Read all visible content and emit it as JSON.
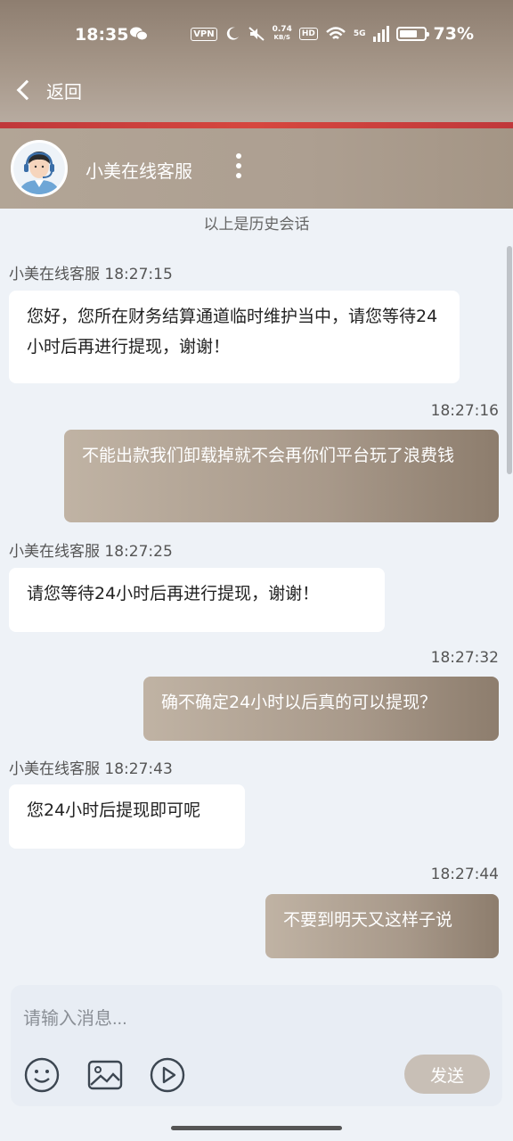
{
  "status_bar": {
    "time": "18:35",
    "vpn": "VPN",
    "net_speed_value": "0.74",
    "net_speed_unit": "KB/S",
    "hd": "HD",
    "signal_label": "5G",
    "battery_percent": "73%",
    "battery_level": 0.73
  },
  "nav": {
    "back_label": "返回"
  },
  "chat_header": {
    "title": "小美在线客服"
  },
  "messages": {
    "history_note": "以上是历史会话",
    "items": [
      {
        "side": "left",
        "meta": "小美在线客服 18:27:15",
        "text": "您好，您所在财务结算通道临时维护当中，请您等待24小时后再进行提现，谢谢！"
      },
      {
        "side": "right",
        "meta": "18:27:16",
        "text": "不能出款我们卸载掉就不会再你们平台玩了浪费钱"
      },
      {
        "side": "left",
        "meta": "小美在线客服 18:27:25",
        "text": "请您等待24小时后再进行提现，谢谢！"
      },
      {
        "side": "right",
        "meta": "18:27:32",
        "text": "确不确定24小时以后真的可以提现？"
      },
      {
        "side": "left",
        "meta": "小美在线客服 18:27:43",
        "text": "您24小时后提现即可呢"
      },
      {
        "side": "right",
        "meta": "18:27:44",
        "text": "不要到明天又这样子说"
      }
    ]
  },
  "composer": {
    "placeholder": "请输入消息...",
    "send_label": "发送",
    "tools": [
      "emoji-icon",
      "image-icon",
      "video-icon"
    ]
  },
  "colors": {
    "header_top": "#8e7e70",
    "accent_red": "#c0383b",
    "bubble_right": "#a8998a",
    "bubble_left": "#ffffff",
    "background": "#eef2f7"
  }
}
